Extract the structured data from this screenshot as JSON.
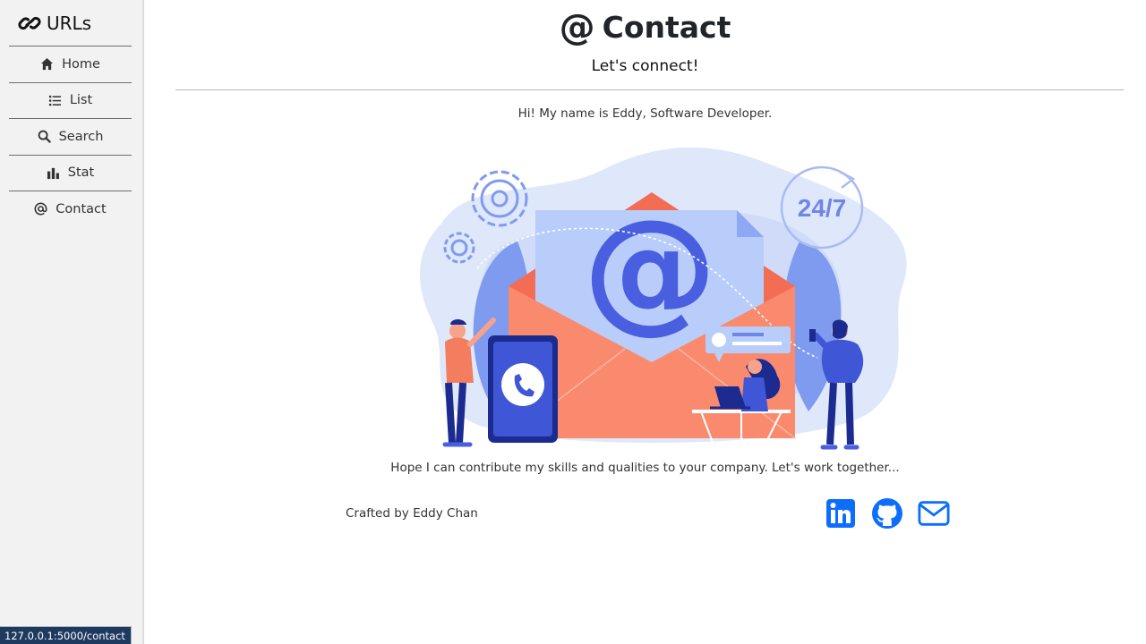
{
  "sidebar": {
    "brand": "URLs",
    "items": [
      {
        "label": "Home",
        "icon": "home-icon"
      },
      {
        "label": "List",
        "icon": "list-icon"
      },
      {
        "label": "Search",
        "icon": "search-icon"
      },
      {
        "label": "Stat",
        "icon": "bar-chart-icon"
      },
      {
        "label": "Contact",
        "icon": "at-icon"
      }
    ]
  },
  "page": {
    "title_symbol": "@",
    "title": "Contact",
    "subtitle": "Let's connect!",
    "intro": "Hi! My name is Eddy, Software Developer.",
    "closing": "Hope I can contribute my skills and qualities to your company. Let's work together...",
    "credit": "Crafted by Eddy Chan"
  },
  "illustration": {
    "badge": "24/7",
    "symbol": "@"
  },
  "social": [
    {
      "name": "linkedin",
      "icon": "linkedin-icon"
    },
    {
      "name": "github",
      "icon": "github-icon"
    },
    {
      "name": "email",
      "icon": "envelope-icon"
    }
  ],
  "statusbar": {
    "url": "127.0.0.1:5000/contact"
  },
  "colors": {
    "accent": "#0d6efd",
    "sidebar_bg": "#f2f2f2",
    "envelope": "#fa8a6e",
    "illustration_blue": "#4a5fe0"
  }
}
